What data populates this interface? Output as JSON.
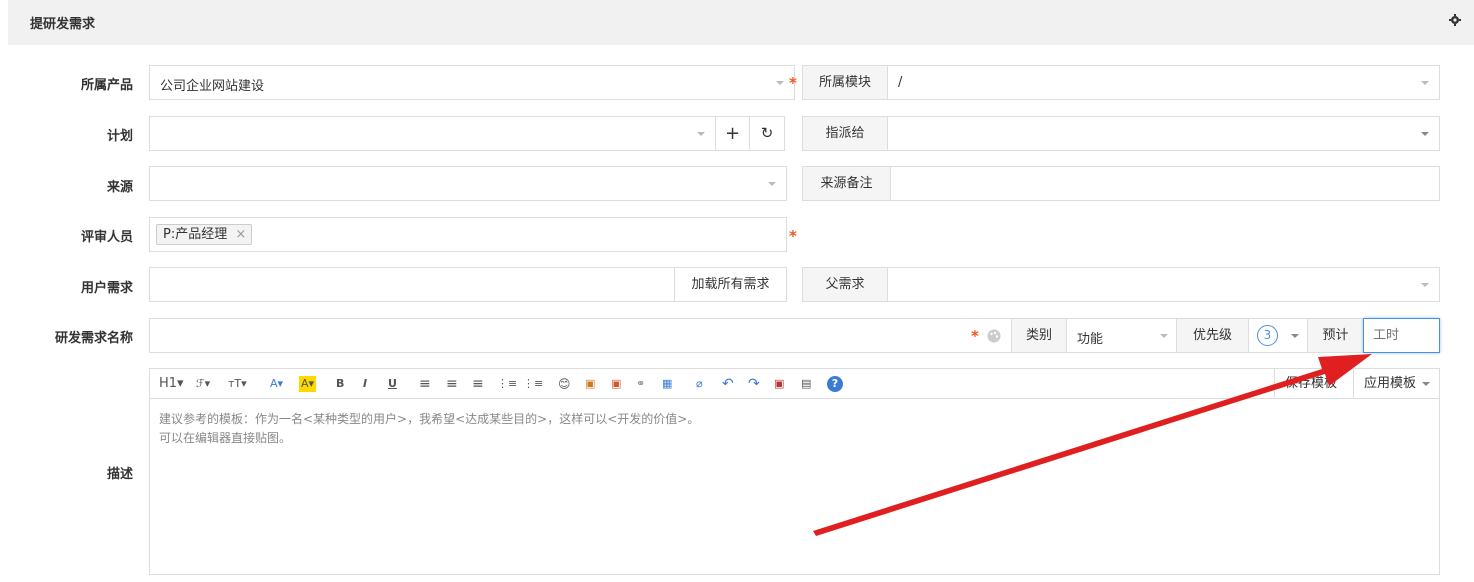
{
  "header": {
    "title": "提研发需求"
  },
  "labels": {
    "product": "所属产品",
    "plan": "计划",
    "source": "来源",
    "reviewer": "评审人员",
    "user_req": "用户需求",
    "name": "研发需求名称",
    "desc": "描述"
  },
  "product": {
    "value": "公司企业网站建设"
  },
  "module": {
    "label": "所属模块",
    "value": "/"
  },
  "assign": {
    "label": "指派给"
  },
  "source_note": {
    "label": "来源备注"
  },
  "reviewer": {
    "chip": "P:产品经理",
    "remove": "×"
  },
  "user_req": {
    "button": "加载所有需求"
  },
  "parent": {
    "label": "父需求"
  },
  "name_row": {
    "type_label": "类别",
    "type_value": "功能",
    "priority_label": "优先级",
    "priority_value": "3",
    "estimate_label": "预计",
    "estimate_placeholder": "工时"
  },
  "required_mark": "*",
  "plan_buttons": {
    "add": "+",
    "refresh": "↻"
  },
  "toolbar": {
    "items": [
      "H1▾",
      "ℱ▾",
      "тT▾",
      "A▾",
      "A▾",
      "B",
      "I",
      "U",
      "≡",
      "≡",
      "≡",
      "⋮≡",
      "⋮≡",
      "😊",
      "▣",
      "▣",
      "⚭",
      "▦",
      "⌀",
      "↶",
      "↷",
      "▣",
      "▤",
      "?"
    ],
    "save_template": "保存模板",
    "apply_template": "应用模板"
  },
  "editor": {
    "placeholder_line1": "建议参考的模板：作为一名<某种类型的用户>，我希望<达成某些目的>，这样可以<开发的价值>。",
    "placeholder_line2": "可以在编辑器直接贴图。"
  },
  "colors": {
    "required": "#ee5522",
    "arrow": "#e02020",
    "header_bg": "#f1f1f1",
    "focus": "#4a90e2"
  }
}
